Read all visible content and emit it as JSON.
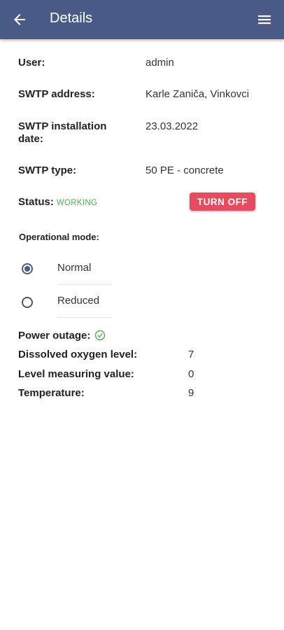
{
  "header": {
    "title": "Details",
    "back_icon": "arrow-left-icon",
    "menu_icon": "hamburger-menu-icon",
    "background": "#4a5a86"
  },
  "details": {
    "user_label": "User:",
    "user_value": "admin",
    "address_label": "SWTP address:",
    "address_value": "Karle Zaniča, Vinkovci",
    "install_label_line1": "SWTP installation",
    "install_label_line2": "date:",
    "install_value": "23.03.2022",
    "type_label": "SWTP type:",
    "type_value": "50 PE - concrete",
    "status_label": "Status:",
    "status_value": "WORKING",
    "status_color": "#4caf50",
    "turn_off_label": "TURN OFF",
    "turn_off_color": "#e94a5f"
  },
  "operational_mode": {
    "label": "Operational mode:",
    "options": [
      {
        "label": "Normal",
        "selected": true
      },
      {
        "label": "Reduced",
        "selected": false
      }
    ]
  },
  "metrics": {
    "power_outage_label": "Power outage:",
    "power_outage_icon": "check-circle-icon",
    "oxygen_label": "Dissolved oxygen level:",
    "oxygen_value": "7",
    "level_label": "Level measuring value:",
    "level_value": "0",
    "temperature_label": "Temperature:",
    "temperature_value": "9"
  }
}
